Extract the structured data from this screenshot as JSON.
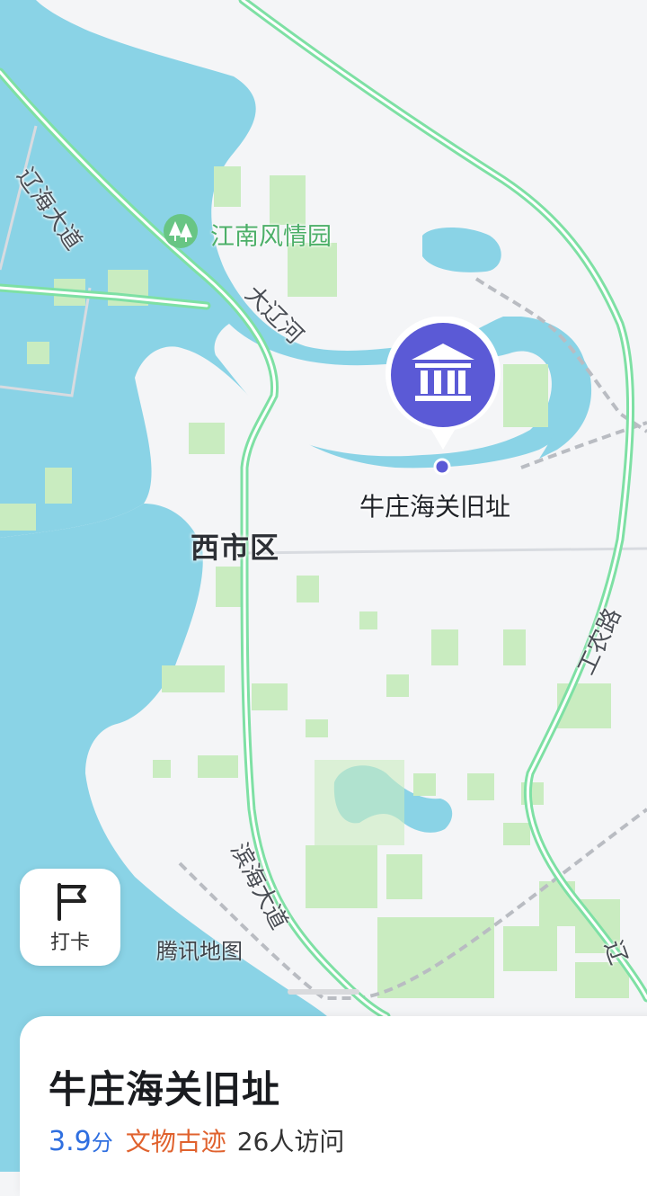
{
  "map": {
    "district_label": "西市区",
    "park_label": "江南风情园",
    "river_label": "大辽河",
    "road_labels": {
      "top_left": "辽海大道",
      "right": "工农路",
      "bottom": "滨海大道",
      "edge": "辽"
    },
    "poi_label": "牛庄海关旧址",
    "watermark": "腾讯地图",
    "marker_icon": "museum-icon",
    "colors": {
      "water": "#8ad3e6",
      "green": "#c9ecc0",
      "road": "#7ee0a4",
      "marker": "#5b5ad6",
      "land": "#f4f5f7"
    }
  },
  "checkin": {
    "icon": "flag-icon",
    "label": "打卡"
  },
  "place": {
    "name": "牛庄海关旧址",
    "rating": "3.9",
    "rating_unit": "分",
    "category": "文物古迹",
    "visits": "26人访问"
  }
}
